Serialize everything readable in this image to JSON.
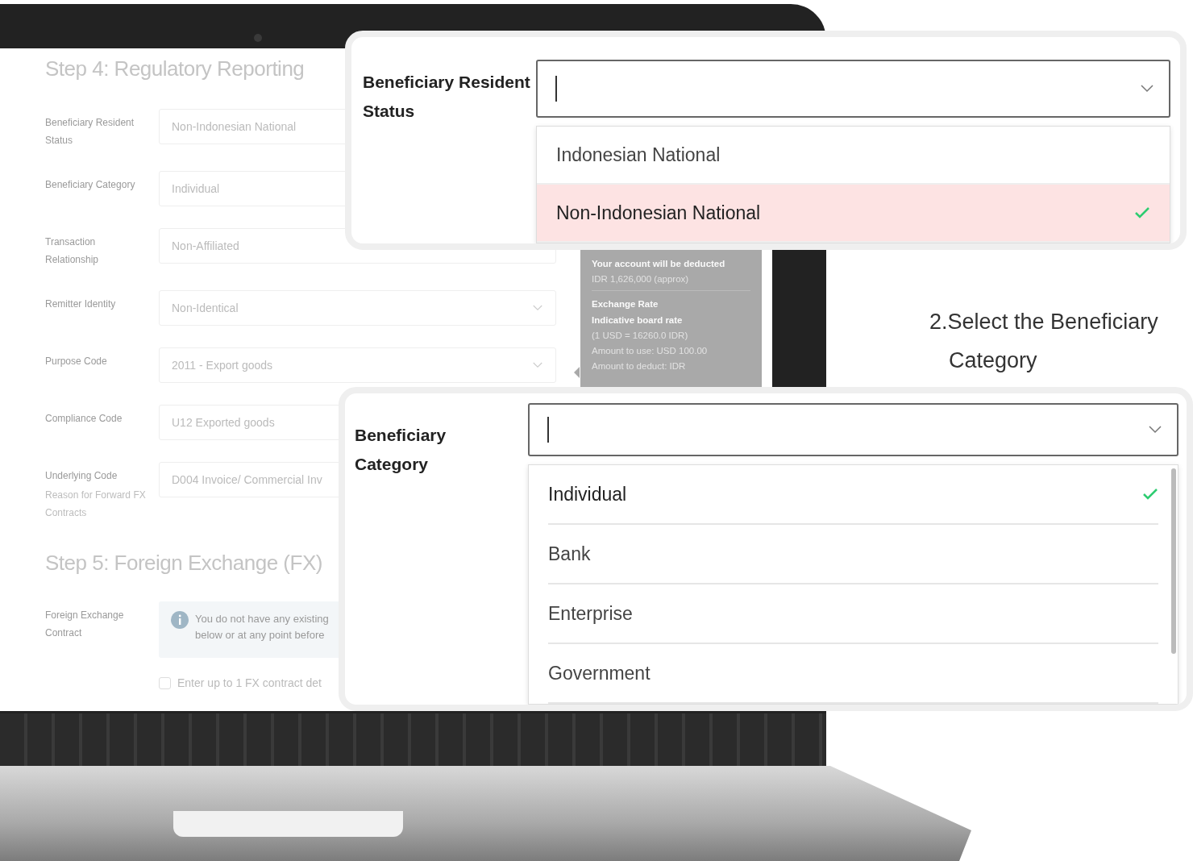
{
  "form": {
    "sections": [
      {
        "heading": "Step 4: Regulatory Reporting",
        "rows": [
          {
            "label": "Beneficiary Resident Status",
            "value": "Non-Indonesian National",
            "kind": "text"
          },
          {
            "label": "Beneficiary Category",
            "value": "Individual",
            "kind": "text"
          },
          {
            "label": "Transaction Relationship",
            "value": "Non-Affiliated",
            "kind": "select"
          },
          {
            "label": "Remitter Identity",
            "value": "Non-Identical",
            "kind": "select"
          },
          {
            "label": "Purpose Code",
            "value": "2011 - Export goods",
            "kind": "select"
          },
          {
            "label": "Compliance Code",
            "value": "U12 Exported goods",
            "kind": "text"
          },
          {
            "label": "Underlying Code",
            "hint": "Reason for Forward FX Contracts",
            "value": "D004 Invoice/ Commercial Inv",
            "kind": "text"
          }
        ]
      },
      {
        "heading": "Step 5: Foreign Exchange (FX)",
        "rows": [
          {
            "label": "Foreign Exchange Contract",
            "kind": "info",
            "lines": [
              "You do not have any existing",
              "below or at any point before"
            ]
          }
        ]
      }
    ],
    "checkbox": {
      "label": "Enter up to 1 FX contract det",
      "checked": false
    }
  },
  "tooltip": {
    "title": "Your account will be deducted",
    "amount": "IDR 1,626,000 (approx)",
    "rate_title": "Exchange Rate",
    "rate_type": "Indicative board rate",
    "lines": [
      "(1 USD = 16260.0 IDR)",
      "Amount to use: USD 100.00",
      "Amount to deduct: IDR"
    ]
  },
  "callouts": [
    {
      "label": "Beneficiary Resident Status",
      "options": [
        {
          "label": "Indonesian National",
          "selected": false,
          "highlighted": false
        },
        {
          "label": "Non-Indonesian National",
          "selected": true,
          "highlighted": true
        }
      ]
    },
    {
      "label": "Beneficiary Category",
      "options": [
        {
          "label": "Individual",
          "selected": true,
          "highlighted": false
        },
        {
          "label": "Bank",
          "selected": false,
          "highlighted": false
        },
        {
          "label": "Enterprise",
          "selected": false,
          "highlighted": false
        },
        {
          "label": "Government",
          "selected": false,
          "highlighted": false
        }
      ]
    }
  ],
  "caption": "2.Select the Beneficiary Category"
}
